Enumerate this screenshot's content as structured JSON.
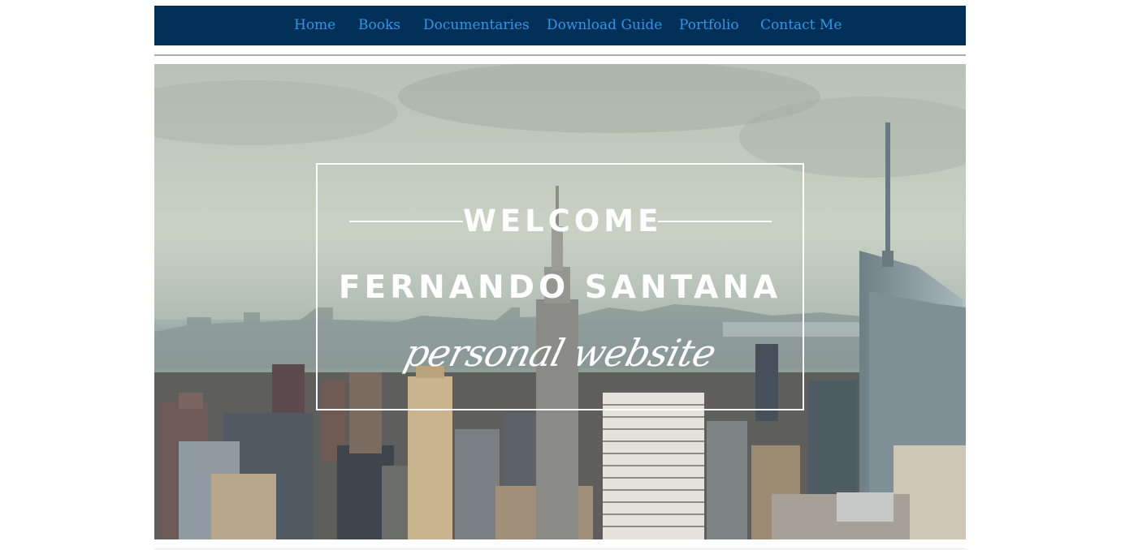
{
  "nav": {
    "items": [
      {
        "label": "Home"
      },
      {
        "label": "Books"
      },
      {
        "label": "Documentaries"
      },
      {
        "label": "Download Guide"
      },
      {
        "label": "Portfolio"
      },
      {
        "label": "Contact Me"
      }
    ]
  },
  "hero": {
    "welcome": "WELCOME",
    "name": "FERNANDO SANTANA",
    "tagline": "personal website"
  },
  "colors": {
    "nav_background": "#003057",
    "nav_link": "#2f97e6",
    "hero_text": "#ffffff"
  }
}
